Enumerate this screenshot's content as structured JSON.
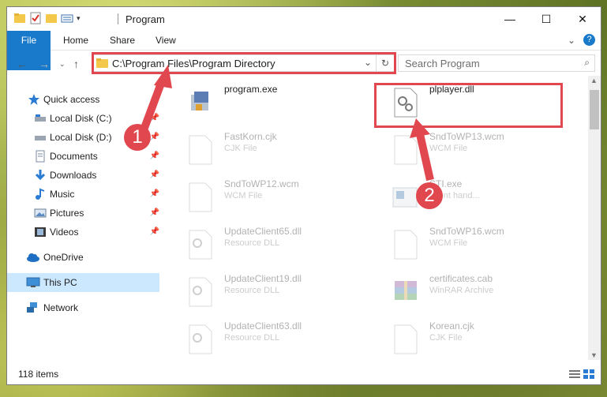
{
  "window": {
    "title": "Program",
    "controls": {
      "minimize": "—",
      "maximize": "☐",
      "close": "✕"
    }
  },
  "ribbon": {
    "tabs": [
      {
        "label": "File"
      },
      {
        "label": "Home"
      },
      {
        "label": "Share"
      },
      {
        "label": "View"
      }
    ],
    "help": "?",
    "collapse": "⌄"
  },
  "address": {
    "path": "C:\\Program Files\\Program Directory",
    "search_placeholder": "Search Program"
  },
  "nav": {
    "items": [
      {
        "label": "Quick access",
        "icon": "star-icon"
      },
      {
        "label": "Local Disk (C:)",
        "icon": "drive-icon"
      },
      {
        "label": "Local Disk (D:)",
        "icon": "drive-icon"
      },
      {
        "label": "Documents",
        "icon": "documents-icon"
      },
      {
        "label": "Downloads",
        "icon": "downloads-icon"
      },
      {
        "label": "Music",
        "icon": "music-icon"
      },
      {
        "label": "Pictures",
        "icon": "pictures-icon"
      },
      {
        "label": "Videos",
        "icon": "videos-icon"
      },
      {
        "label": "OneDrive",
        "icon": "cloud-icon"
      },
      {
        "label": "This PC",
        "icon": "pc-icon"
      },
      {
        "label": "Network",
        "icon": "network-icon"
      }
    ]
  },
  "files": [
    {
      "name": "program.exe",
      "type": "",
      "icon": "exe-icon"
    },
    {
      "name": "plplayer.dll",
      "type": "",
      "icon": "dll-icon"
    },
    {
      "name": "FastKorn.cjk",
      "type": "CJK File",
      "icon": "file-icon"
    },
    {
      "name": "SndToWP13.wcm",
      "type": "WCM File",
      "icon": "file-icon"
    },
    {
      "name": "SndToWP12.wcm",
      "type": "WCM File",
      "icon": "file-icon"
    },
    {
      "name": "STI.exe",
      "type": "event hand...",
      "icon": "exe-icon"
    },
    {
      "name": "UpdateClient65.dll",
      "type": "Resource DLL",
      "icon": "dll-icon"
    },
    {
      "name": "SndToWP16.wcm",
      "type": "WCM File",
      "icon": "file-icon"
    },
    {
      "name": "UpdateClient19.dll",
      "type": "Resource DLL",
      "icon": "dll-icon"
    },
    {
      "name": "certificates.cab",
      "type": "WinRAR Archive",
      "icon": "archive-icon"
    },
    {
      "name": "UpdateClient63.dll",
      "type": "Resource DLL",
      "icon": "dll-icon"
    },
    {
      "name": "Korean.cjk",
      "type": "CJK File",
      "icon": "file-icon"
    }
  ],
  "status": {
    "count": "118 items"
  },
  "annotations": {
    "step1": "1",
    "step2": "2"
  },
  "colors": {
    "accent": "#1979ca",
    "highlight": "#e0474f"
  }
}
